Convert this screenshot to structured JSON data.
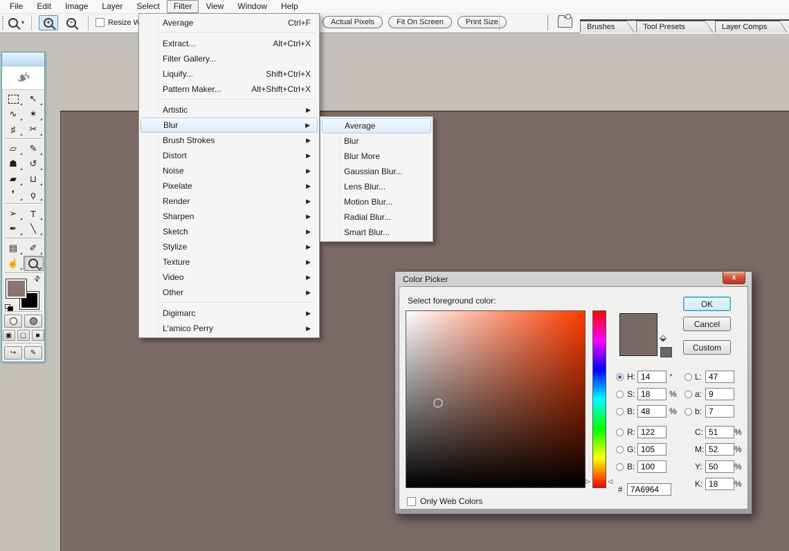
{
  "app": {
    "canvas_color": "#7C6A65",
    "workspace_color": "#C4C1BB"
  },
  "menu_bar": {
    "items": [
      "File",
      "Edit",
      "Image",
      "Layer",
      "Select",
      "Filter",
      "View",
      "Window",
      "Help"
    ],
    "active": "Filter"
  },
  "options_bar": {
    "zoom_dropdown_caret": "▾",
    "zoom_in_glyph": "+",
    "zoom_out_glyph": "−",
    "resize_checkbox_label": "Resize Window",
    "view_buttons": [
      "Actual Pixels",
      "Fit On Screen",
      "Print Size"
    ],
    "palette_tabs": [
      "Brushes",
      "Tool Presets",
      "Layer Comps"
    ]
  },
  "filter_menu": {
    "items": [
      {
        "label": "Average",
        "shortcut": "Ctrl+F"
      },
      {
        "separator": true
      },
      {
        "label": "Extract...",
        "shortcut": "Alt+Ctrl+X"
      },
      {
        "label": "Filter Gallery..."
      },
      {
        "label": "Liquify...",
        "shortcut": "Shift+Ctrl+X"
      },
      {
        "label": "Pattern Maker...",
        "shortcut": "Alt+Shift+Ctrl+X"
      },
      {
        "separator": true
      },
      {
        "label": "Artistic",
        "submenu": true
      },
      {
        "label": "Blur",
        "submenu": true,
        "highlighted": true
      },
      {
        "label": "Brush Strokes",
        "submenu": true
      },
      {
        "label": "Distort",
        "submenu": true
      },
      {
        "label": "Noise",
        "submenu": true
      },
      {
        "label": "Pixelate",
        "submenu": true
      },
      {
        "label": "Render",
        "submenu": true
      },
      {
        "label": "Sharpen",
        "submenu": true
      },
      {
        "label": "Sketch",
        "submenu": true
      },
      {
        "label": "Stylize",
        "submenu": true
      },
      {
        "label": "Texture",
        "submenu": true
      },
      {
        "label": "Video",
        "submenu": true
      },
      {
        "label": "Other",
        "submenu": true
      },
      {
        "separator": true
      },
      {
        "label": "Digimarc",
        "submenu": true
      },
      {
        "label": "L'amico Perry",
        "submenu": true
      }
    ]
  },
  "blur_submenu": {
    "items": [
      {
        "label": "Average",
        "highlighted": true
      },
      {
        "label": "Blur"
      },
      {
        "label": "Blur More"
      },
      {
        "label": "Gaussian Blur..."
      },
      {
        "label": "Lens Blur..."
      },
      {
        "label": "Motion Blur..."
      },
      {
        "label": "Radial Blur..."
      },
      {
        "label": "Smart Blur..."
      }
    ]
  },
  "toolbox": {
    "feather_glyph": "❧",
    "tools": [
      {
        "name": "rectangular-marquee-tool",
        "icon": "dashed-box"
      },
      {
        "name": "move-tool",
        "glyph": "↖"
      },
      {
        "name": "lasso-tool",
        "glyph": "∿"
      },
      {
        "name": "magic-wand-tool",
        "glyph": "✶"
      },
      {
        "name": "crop-tool",
        "glyph": "♯"
      },
      {
        "name": "slice-tool",
        "glyph": "✂"
      },
      {
        "name": "healing-brush-tool",
        "glyph": "▱"
      },
      {
        "name": "brush-tool",
        "glyph": "✎"
      },
      {
        "name": "clone-stamp-tool",
        "glyph": "☗"
      },
      {
        "name": "history-brush-tool",
        "glyph": "↺"
      },
      {
        "name": "eraser-tool",
        "glyph": "▰"
      },
      {
        "name": "paint-bucket-tool",
        "glyph": "⊔"
      },
      {
        "name": "blur-tool",
        "glyph": "❜"
      },
      {
        "name": "dodge-tool",
        "glyph": "ϙ"
      },
      {
        "name": "path-selection-tool",
        "glyph": "➢"
      },
      {
        "name": "type-tool",
        "glyph": "T"
      },
      {
        "name": "pen-tool",
        "glyph": "✒"
      },
      {
        "name": "line-tool",
        "glyph": "╲"
      },
      {
        "name": "notes-tool",
        "glyph": "▤"
      },
      {
        "name": "eyedropper-tool",
        "glyph": "✐"
      },
      {
        "name": "hand-tool",
        "glyph": "☝"
      },
      {
        "name": "zoom-tool",
        "icon": "mag",
        "selected": true
      }
    ],
    "dividers_after": [
      5,
      13,
      17
    ],
    "foreground_color": "#8A7570",
    "background_color": "#000000",
    "swap_glyph": "⇄",
    "jump_glyphs": [
      "↪",
      "✎"
    ]
  },
  "color_picker": {
    "title": "Color Picker",
    "close_glyph": "x",
    "prompt": "Select foreground color:",
    "buttons": {
      "ok": "OK",
      "cancel": "Cancel",
      "custom": "Custom"
    },
    "field": {
      "hue_color": "#FF3B00",
      "marker_x_pct": 18,
      "marker_y_pct": 52
    },
    "hue_arrow_left": "▷",
    "hue_arrow_right": "◁",
    "swatch_color": "#7A6964",
    "websafe_color": "#666666",
    "values": {
      "hsb": [
        {
          "label": "H:",
          "value": "14",
          "unit": "°",
          "selected": true
        },
        {
          "label": "S:",
          "value": "18",
          "unit": "%"
        },
        {
          "label": "B:",
          "value": "48",
          "unit": "%"
        }
      ],
      "lab": [
        {
          "label": "L:",
          "value": "47"
        },
        {
          "label": "a:",
          "value": "9"
        },
        {
          "label": "b:",
          "value": "7"
        }
      ],
      "rgb": [
        {
          "label": "R:",
          "value": "122"
        },
        {
          "label": "G:",
          "value": "105"
        },
        {
          "label": "B:",
          "value": "100"
        }
      ],
      "cmyk": [
        {
          "label": "C:",
          "value": "51",
          "unit": "%"
        },
        {
          "label": "M:",
          "value": "52",
          "unit": "%"
        },
        {
          "label": "Y:",
          "value": "50",
          "unit": "%"
        },
        {
          "label": "K:",
          "value": "18",
          "unit": "%"
        }
      ]
    },
    "hex": {
      "prefix": "#",
      "value": "7A6964"
    },
    "web_colors_label": "Only Web Colors"
  }
}
